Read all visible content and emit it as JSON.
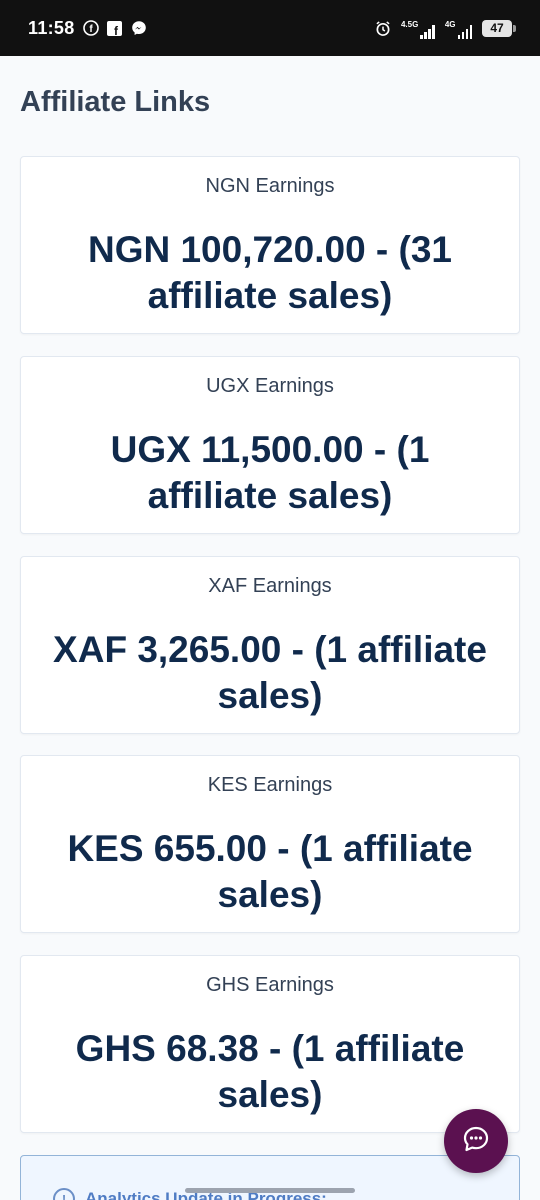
{
  "status_bar": {
    "time": "11:58",
    "network_1": "4.5G",
    "network_2": "4G",
    "battery": "47"
  },
  "page": {
    "title": "Affiliate Links"
  },
  "earnings": [
    {
      "label": "NGN Earnings",
      "value": "NGN 100,720.00 - (31 affiliate sales)"
    },
    {
      "label": "UGX Earnings",
      "value": "UGX 11,500.00 - (1 affiliate sales)"
    },
    {
      "label": "XAF Earnings",
      "value": "XAF 3,265.00 - (1 affiliate sales)"
    },
    {
      "label": "KES Earnings",
      "value": "KES 655.00 - (1 affiliate sales)"
    },
    {
      "label": "GHS Earnings",
      "value": "GHS 68.38 - (1 affiliate sales)"
    }
  ],
  "notice": {
    "text": "Analytics Update in Progress:"
  },
  "colors": {
    "chat_button": "#5b1150",
    "value_text": "#102a4c",
    "notice_text": "#4f7cc4"
  }
}
